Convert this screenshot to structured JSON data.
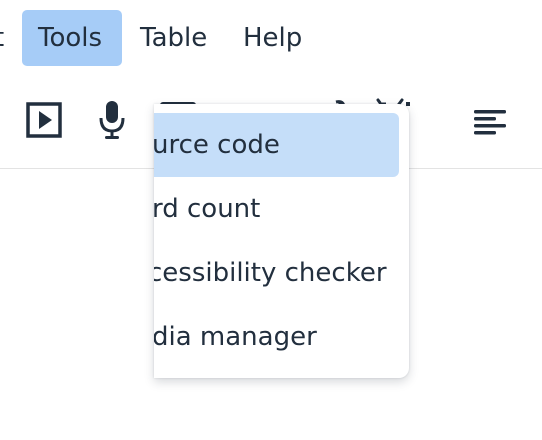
{
  "menubar": {
    "partial_left": "t",
    "items": [
      {
        "label": "Tools",
        "active": true
      },
      {
        "label": "Table",
        "active": false
      },
      {
        "label": "Help",
        "active": false
      }
    ]
  },
  "toolbar": {
    "buttons": [
      {
        "name": "media-play-icon"
      },
      {
        "name": "microphone-icon"
      },
      {
        "name": "video-camera-icon"
      },
      {
        "name": "format-painter-icon"
      },
      {
        "name": "link-icon"
      },
      {
        "name": "unlink-icon"
      },
      {
        "name": "align-left-icon"
      }
    ]
  },
  "dropdown": {
    "items": [
      {
        "label": "urce code",
        "selected": true
      },
      {
        "label": "rd count",
        "selected": false
      },
      {
        "label": "cessibility checker",
        "selected": false
      },
      {
        "label": "dia manager",
        "selected": false
      }
    ]
  },
  "colors": {
    "menu_active_bg": "#a6ccf7",
    "item_selected_bg": "#c5def9",
    "text": "#222f3e"
  }
}
